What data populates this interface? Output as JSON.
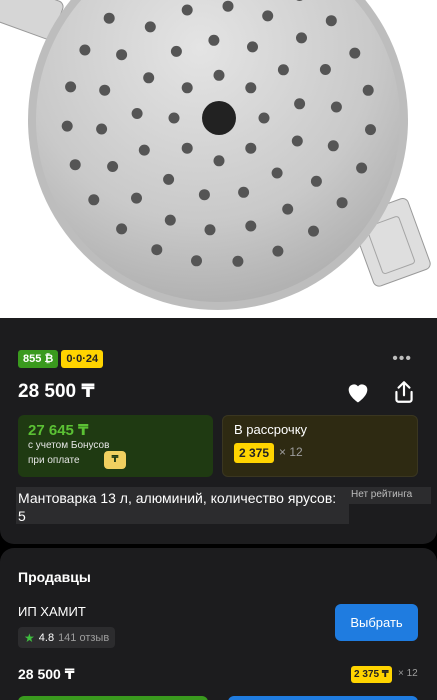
{
  "product": {
    "bonus_badge": "855 ₿",
    "installment_badge": "0·0·24",
    "more_icon": "more-horizontal-icon",
    "price": "28 500 ₸",
    "favorite_icon": "heart-icon",
    "share_icon": "share-icon",
    "bonus_price": "27 645 ₸",
    "bonus_note_line1": "с учетом Бонусов",
    "bonus_note_line2": "при оплате",
    "installment_label": "В рассрочку",
    "installment_amount": "2 375",
    "installment_times": "× 12",
    "title": "Мантоварка 13 л, алюминий, количество ярусов: 5",
    "rating_text": "Нет рейтинга"
  },
  "sellers": {
    "heading": "Продавцы",
    "items": [
      {
        "name": "ИП ХАМИТ",
        "rating": "4.8",
        "reviews": "141 отзыв",
        "choose_label": "Выбрать",
        "price": "28 500 ₸",
        "installment_amount": "2 375 ₸",
        "installment_times": "× 12"
      }
    ]
  },
  "colors": {
    "bonus_green": "#5bc134",
    "installment_yellow": "#ffd400",
    "primary_blue": "#1f7ce0",
    "card_bg": "#1c1c1e"
  }
}
